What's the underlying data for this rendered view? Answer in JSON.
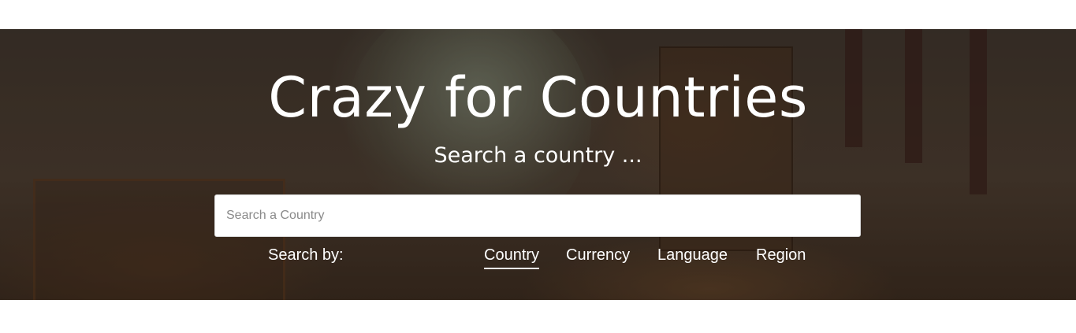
{
  "hero": {
    "title": "Crazy for Countries",
    "subtitle": "Search a country ..."
  },
  "search": {
    "placeholder": "Search a Country",
    "value": ""
  },
  "search_by": {
    "label": "Search by:",
    "tabs": [
      {
        "label": "Country",
        "active": true
      },
      {
        "label": "Currency",
        "active": false
      },
      {
        "label": "Language",
        "active": false
      },
      {
        "label": "Region",
        "active": false
      }
    ]
  },
  "colors": {
    "text": "#ffffff",
    "input_bg": "#ffffff",
    "page_bg": "#ffffff"
  }
}
